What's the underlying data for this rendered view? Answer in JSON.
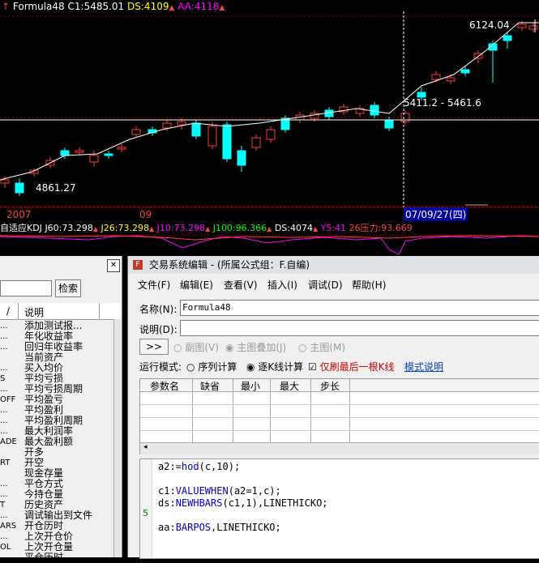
{
  "chart": {
    "indicator_name": "Formula48",
    "close": "C1:5485.01",
    "ds": "DS:4109",
    "aa": "AA:4118",
    "high_label": "6124.04",
    "low_label": "4861.27",
    "crosshair_range": "5411.2 - 5461.6",
    "date_cursor": "07/09/27(四)",
    "axis_year": "2007",
    "axis_month": "09",
    "kdj": {
      "name": "自适应KDJ",
      "j60": "J60:73.298",
      "j26": "J26:73.298",
      "j10": "J10:73.298",
      "j100": "J100:96.366",
      "ds": "DS:4074",
      "y5": "Y5:41",
      "pressure": "26压力:93.669"
    },
    "colors": {
      "up": "#ff3c3c",
      "down": "#00ffff",
      "ma": "#ffffff",
      "grid": "#9b0000",
      "magenta": "#ff00ff",
      "yellow": "#ffff00"
    }
  },
  "left_panel": {
    "search_button": "检索",
    "col_dots": "/",
    "col_desc": "说明",
    "rows": [
      {
        "k": "...",
        "v": "添加测试报..."
      },
      {
        "k": "...",
        "v": "年化收益率"
      },
      {
        "k": "...",
        "v": "回归年收益率"
      },
      {
        "k": "",
        "v": "当前资产"
      },
      {
        "k": "...",
        "v": "买入均价"
      },
      {
        "k": "S",
        "v": "平均亏损"
      },
      {
        "k": "...",
        "v": "平均亏损周期"
      },
      {
        "k": "OFF",
        "v": "平均盈亏"
      },
      {
        "k": "...",
        "v": "平均盈利"
      },
      {
        "k": "...",
        "v": "平均盈利周期"
      },
      {
        "k": "...",
        "v": "最大利润率"
      },
      {
        "k": "ADE",
        "v": "最大盈利额"
      },
      {
        "k": "",
        "v": "开多"
      },
      {
        "k": "RT",
        "v": "开空"
      },
      {
        "k": "",
        "v": "现金存量"
      },
      {
        "k": "...",
        "v": "平仓方式"
      },
      {
        "k": "...",
        "v": "今持仓量"
      },
      {
        "k": "T",
        "v": "历史资产"
      },
      {
        "k": "...",
        "v": "调试输出到文件"
      },
      {
        "k": "ARS",
        "v": "开仓历时"
      },
      {
        "k": "...",
        "v": "上次开仓价"
      },
      {
        "k": "OL",
        "v": "上次开仓量"
      },
      {
        "k": "...",
        "v": "平仓历时"
      }
    ]
  },
  "editor": {
    "title": "交易系统编辑 - (所属公式组：F.自编)",
    "menu": [
      "文件(F)",
      "编辑(E)",
      "查看(V)",
      "插入(I)",
      "调试(D)",
      "帮助(H)"
    ],
    "name_label": "名称(N):",
    "name_value": "Formula48",
    "desc_label": "说明(D):",
    "desc_value": "",
    "expand_btn": ">>",
    "radio_sub": "副图(V)",
    "radio_overlay": "主图叠加(J)",
    "radio_main": "主图(M)",
    "run_mode_label": "运行模式:",
    "run_seq": "序列计算",
    "run_bar": "逐K线计算",
    "only_last": "仅刷最后一根K线",
    "mode_link": "模式说明",
    "params_headers": [
      "参数名",
      "缺省",
      "最小",
      "最大",
      "步长"
    ],
    "gutter_marker": "5",
    "code": [
      {
        "pre": "a2:=",
        "kw": "hod",
        "post": "(c,10);"
      },
      {
        "pre": "",
        "kw": "",
        "post": ""
      },
      {
        "pre": "c1:",
        "kw": "VALUEWHEN",
        "post": "(a2=1,c);"
      },
      {
        "pre": "ds:",
        "kw": "NEWHBARS",
        "post": "(c1,1),LINETHICKO;"
      },
      {
        "pre": "",
        "kw": "",
        "post": ""
      },
      {
        "pre": "aa:",
        "kw": "BARPOS",
        "post": ",LINETHICKO;"
      }
    ]
  }
}
